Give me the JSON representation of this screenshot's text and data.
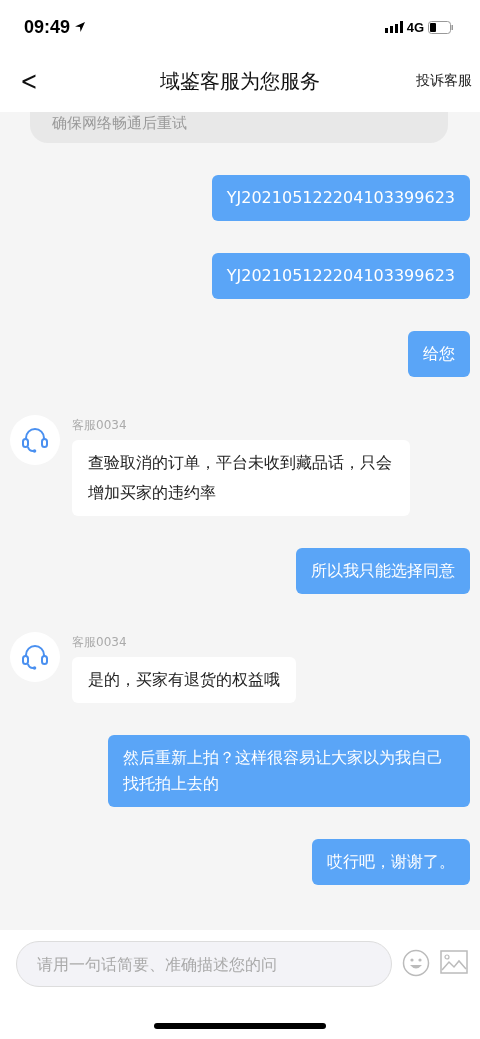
{
  "status_bar": {
    "time": "09:49",
    "network": "4G"
  },
  "nav": {
    "back": "<",
    "title": "域鉴客服为您服务",
    "action": "投诉客服"
  },
  "messages": [
    {
      "kind": "notice",
      "text": "确保网络畅通后重试"
    },
    {
      "kind": "sent",
      "text": "YJ202105122204103399623"
    },
    {
      "kind": "sent",
      "text": "YJ202105122204103399623"
    },
    {
      "kind": "sent",
      "text": "给您"
    },
    {
      "kind": "received",
      "sender": "客服0034",
      "text": "查验取消的订单，平台未收到藏品话，只会增加买家的违约率"
    },
    {
      "kind": "sent",
      "text": "所以我只能选择同意"
    },
    {
      "kind": "received",
      "sender": "客服0034",
      "text": "是的，买家有退货的权益哦"
    },
    {
      "kind": "sent",
      "text": "然后重新上拍？这样很容易让大家以为我自己找托拍上去的"
    },
    {
      "kind": "sent",
      "text": "哎行吧，谢谢了。"
    }
  ],
  "composer": {
    "placeholder": "请用一句话简要、准确描述您的问"
  }
}
